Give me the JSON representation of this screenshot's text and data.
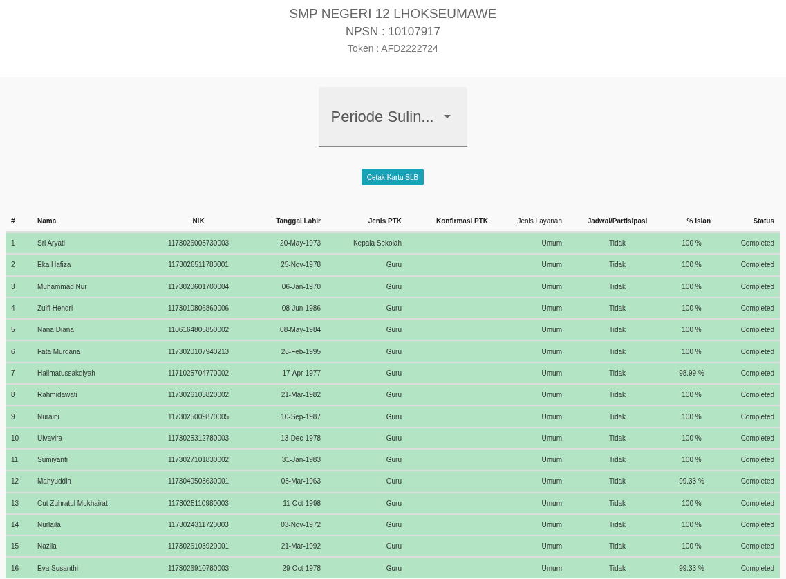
{
  "header": {
    "title": "SMP NEGERI 12 LHOKSEUMAWE",
    "npsn": "NPSN : 10107917",
    "token": "Token : AFD2222724"
  },
  "period_select": {
    "value": "Periode Sulin..."
  },
  "print_button": {
    "label": "Cetak Kartu SLB"
  },
  "table": {
    "columns": [
      {
        "label": "#",
        "bold": true
      },
      {
        "label": "Nama",
        "bold": true
      },
      {
        "label": "NIK",
        "bold": true
      },
      {
        "label": "Tanggal Lahir",
        "bold": true
      },
      {
        "label": "Jenis PTK",
        "bold": true
      },
      {
        "label": "Konfirmasi PTK",
        "bold": true
      },
      {
        "label": "Jenis Layanan",
        "bold": false
      },
      {
        "label": "Jadwal/Partisipasi",
        "bold": true
      },
      {
        "label": "% Isian",
        "bold": true
      },
      {
        "label": "Status",
        "bold": true
      }
    ],
    "rows": [
      {
        "no": "1",
        "nama": "Sri Aryati",
        "nik": "1173026005730003",
        "tanggal_lahir": "20-May-1973",
        "jenis_ptk": "Kepala Sekolah",
        "jenis_layanan": "Umum",
        "jadwal": "Tidak",
        "isian": "100 %",
        "status": "Completed"
      },
      {
        "no": "2",
        "nama": "Eka Hafiza",
        "nik": "1173026511780001",
        "tanggal_lahir": "25-Nov-1978",
        "jenis_ptk": "Guru",
        "jenis_layanan": "Umum",
        "jadwal": "Tidak",
        "isian": "100 %",
        "status": "Completed"
      },
      {
        "no": "3",
        "nama": "Muhammad Nur",
        "nik": "1173020601700004",
        "tanggal_lahir": "06-Jan-1970",
        "jenis_ptk": "Guru",
        "jenis_layanan": "Umum",
        "jadwal": "Tidak",
        "isian": "100 %",
        "status": "Completed"
      },
      {
        "no": "4",
        "nama": "Zulfi Hendri",
        "nik": "1173010806860006",
        "tanggal_lahir": "08-Jun-1986",
        "jenis_ptk": "Guru",
        "jenis_layanan": "Umum",
        "jadwal": "Tidak",
        "isian": "100 %",
        "status": "Completed"
      },
      {
        "no": "5",
        "nama": "Nana Diana",
        "nik": "1106164805850002",
        "tanggal_lahir": "08-May-1984",
        "jenis_ptk": "Guru",
        "jenis_layanan": "Umum",
        "jadwal": "Tidak",
        "isian": "100 %",
        "status": "Completed"
      },
      {
        "no": "6",
        "nama": "Fata Murdana",
        "nik": "1173020107940213",
        "tanggal_lahir": "28-Feb-1995",
        "jenis_ptk": "Guru",
        "jenis_layanan": "Umum",
        "jadwal": "Tidak",
        "isian": "100 %",
        "status": "Completed"
      },
      {
        "no": "7",
        "nama": "Halimatussakdiyah",
        "nik": "1171025704770002",
        "tanggal_lahir": "17-Apr-1977",
        "jenis_ptk": "Guru",
        "jenis_layanan": "Umum",
        "jadwal": "Tidak",
        "isian": "98.99 %",
        "status": "Completed"
      },
      {
        "no": "8",
        "nama": "Rahmidawati",
        "nik": "1173026103820002",
        "tanggal_lahir": "21-Mar-1982",
        "jenis_ptk": "Guru",
        "jenis_layanan": "Umum",
        "jadwal": "Tidak",
        "isian": "100 %",
        "status": "Completed"
      },
      {
        "no": "9",
        "nama": "Nuraini",
        "nik": "1173025009870005",
        "tanggal_lahir": "10-Sep-1987",
        "jenis_ptk": "Guru",
        "jenis_layanan": "Umum",
        "jadwal": "Tidak",
        "isian": "100 %",
        "status": "Completed"
      },
      {
        "no": "10",
        "nama": "Ulvavira",
        "nik": "1173025312780003",
        "tanggal_lahir": "13-Dec-1978",
        "jenis_ptk": "Guru",
        "jenis_layanan": "Umum",
        "jadwal": "Tidak",
        "isian": "100 %",
        "status": "Completed"
      },
      {
        "no": "11",
        "nama": "Sumiyanti",
        "nik": "1173027101830002",
        "tanggal_lahir": "31-Jan-1983",
        "jenis_ptk": "Guru",
        "jenis_layanan": "Umum",
        "jadwal": "Tidak",
        "isian": "100 %",
        "status": "Completed"
      },
      {
        "no": "12",
        "nama": "Mahyuddin",
        "nik": "1173040503630001",
        "tanggal_lahir": "05-Mar-1963",
        "jenis_ptk": "Guru",
        "jenis_layanan": "Umum",
        "jadwal": "Tidak",
        "isian": "99.33 %",
        "status": "Completed"
      },
      {
        "no": "13",
        "nama": "Cut Zuhratul Mukhairat",
        "nik": "1173025110980003",
        "tanggal_lahir": "11-Oct-1998",
        "jenis_ptk": "Guru",
        "jenis_layanan": "Umum",
        "jadwal": "Tidak",
        "isian": "100 %",
        "status": "Completed"
      },
      {
        "no": "14",
        "nama": "Nurlaila",
        "nik": "1173024311720003",
        "tanggal_lahir": "03-Nov-1972",
        "jenis_ptk": "Guru",
        "jenis_layanan": "Umum",
        "jadwal": "Tidak",
        "isian": "100 %",
        "status": "Completed"
      },
      {
        "no": "15",
        "nama": "Nazlia",
        "nik": "1173026103920001",
        "tanggal_lahir": "21-Mar-1992",
        "jenis_ptk": "Guru",
        "jenis_layanan": "Umum",
        "jadwal": "Tidak",
        "isian": "100 %",
        "status": "Completed"
      },
      {
        "no": "16",
        "nama": "Eva Susanthi",
        "nik": "1173026910780003",
        "tanggal_lahir": "29-Oct-1978",
        "jenis_ptk": "Guru",
        "jenis_layanan": "Umum",
        "jadwal": "Tidak",
        "isian": "99.33 %",
        "status": "Completed"
      }
    ]
  }
}
